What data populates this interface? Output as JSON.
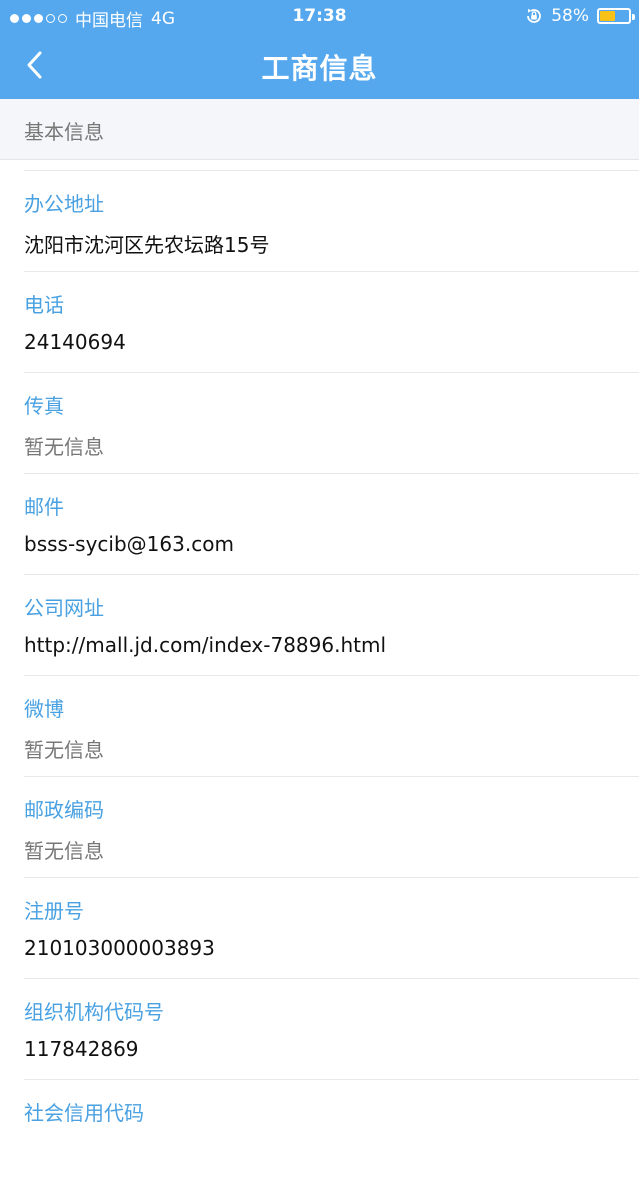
{
  "status_bar": {
    "carrier": "中国电信",
    "network": "4G",
    "time": "17:38",
    "battery_percent_label": "58%",
    "battery_level": 0.58,
    "signal_strength": 3,
    "signal_max": 5,
    "battery_color": "#f7c117"
  },
  "nav": {
    "title": "工商信息",
    "back_icon": "chevron-left-icon"
  },
  "section": {
    "label": "基本信息"
  },
  "fields": [
    {
      "label": "办公地址",
      "value": "沈阳市沈河区先农坛路15号",
      "muted": false
    },
    {
      "label": "电话",
      "value": "24140694",
      "muted": false
    },
    {
      "label": "传真",
      "value": "暂无信息",
      "muted": true
    },
    {
      "label": "邮件",
      "value": "bsss-sycib@163.com",
      "muted": false
    },
    {
      "label": "公司网址",
      "value": "http://mall.jd.com/index-78896.html",
      "muted": false
    },
    {
      "label": "微博",
      "value": "暂无信息",
      "muted": true
    },
    {
      "label": "邮政编码",
      "value": "暂无信息",
      "muted": true
    },
    {
      "label": "注册号",
      "value": "210103000003893",
      "muted": false
    },
    {
      "label": "组织机构代码号",
      "value": "117842869",
      "muted": false
    },
    {
      "label": "社会信用代码",
      "value": "",
      "muted": false
    }
  ],
  "colors": {
    "header": "#56a8ee",
    "label": "#49a1e2",
    "value": "#111111",
    "muted": "#777777"
  }
}
